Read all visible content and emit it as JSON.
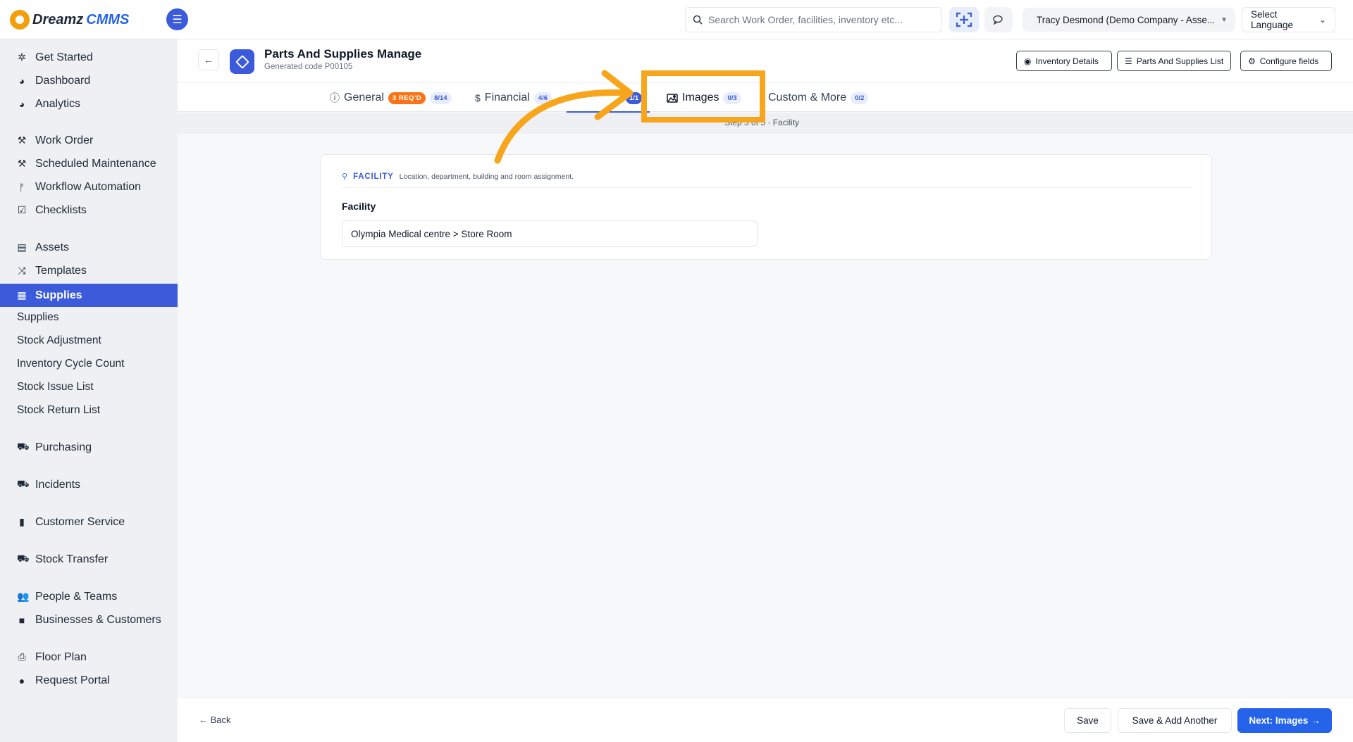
{
  "app": {
    "logo_part1": "Dreamz",
    "logo_part2": "CMMS"
  },
  "header": {
    "search_placeholder": "Search Work Order, facilities, inventory etc...",
    "user_label": "Tracy Desmond (Demo Company - Asse...",
    "language_label": "Select Language"
  },
  "sidebar": {
    "items": [
      {
        "label": "Get Started",
        "icon": "rocket-icon"
      },
      {
        "label": "Dashboard",
        "icon": "gauge-icon"
      },
      {
        "label": "Analytics",
        "icon": "gauge-icon"
      },
      {
        "label": "Work Order",
        "icon": "wrench-icon"
      },
      {
        "label": "Scheduled Maintenance",
        "icon": "wrench-icon"
      },
      {
        "label": "Workflow Automation",
        "icon": "branch-icon"
      },
      {
        "label": "Checklists",
        "icon": "checkbox-icon"
      },
      {
        "label": "Assets",
        "icon": "archive-icon"
      },
      {
        "label": "Templates",
        "icon": "shuffle-icon"
      },
      {
        "label": "Supplies",
        "icon": "supplies-icon"
      },
      {
        "label": "Supplies"
      },
      {
        "label": "Stock Adjustment"
      },
      {
        "label": "Inventory Cycle Count"
      },
      {
        "label": "Stock Issue List"
      },
      {
        "label": "Stock Return List"
      },
      {
        "label": "Purchasing",
        "icon": "cart-icon"
      },
      {
        "label": "Incidents",
        "icon": "cart-icon"
      },
      {
        "label": "Customer Service",
        "icon": "file-icon"
      },
      {
        "label": "Stock Transfer",
        "icon": "truck-icon"
      },
      {
        "label": "People & Teams",
        "icon": "users-icon"
      },
      {
        "label": "Businesses & Customers",
        "icon": "video-icon"
      },
      {
        "label": "Floor Plan",
        "icon": "printer-icon"
      },
      {
        "label": "Request Portal",
        "icon": "comment-icon"
      }
    ]
  },
  "page": {
    "title": "Parts And Supplies Manage",
    "subtitle": "Generated code P00105",
    "buttons": {
      "inventory_details": "Inventory Details",
      "parts_list": "Parts And Supplies List",
      "configure_fields": "Configure fields"
    }
  },
  "tabs": [
    {
      "label": "General",
      "required": "3 REQ'D",
      "count": "8/14"
    },
    {
      "label": "Financial",
      "count": "4/6"
    },
    {
      "count": "1/1"
    },
    {
      "label": "Images",
      "count": "0/3"
    },
    {
      "label": "Custom & More",
      "count": "0/2"
    }
  ],
  "step_strip": {
    "text": "Step 3 of 5 · Facility"
  },
  "section": {
    "title": "FACILITY",
    "description": "Location, department, building and room assignment.",
    "field_label": "Facility",
    "field_value": "Olympia Medical centre > Store Room"
  },
  "footer": {
    "back": "← Back",
    "save": "Save",
    "save_add": "Save & Add Another",
    "next": "Next: Images →"
  },
  "colors": {
    "accent": "#3b5bdb",
    "warning": "#f97316",
    "annotation": "#f7a51c"
  }
}
